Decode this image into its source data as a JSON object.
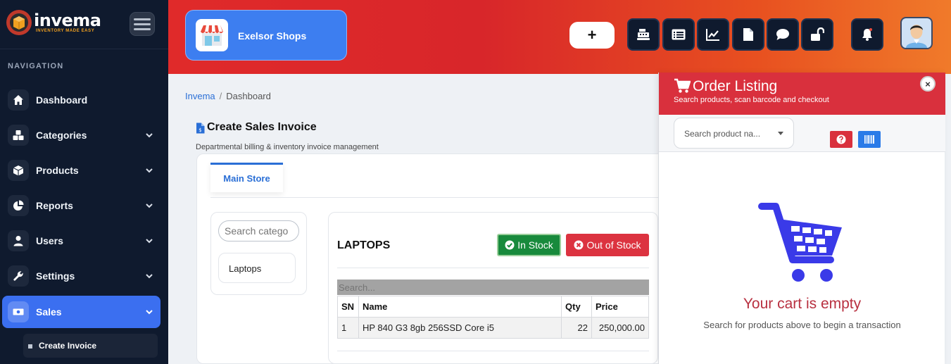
{
  "app": {
    "logo_text": "invema",
    "logo_tagline": "INVENTORY MADE EASY"
  },
  "sidebar": {
    "heading": "NAVIGATION",
    "items": [
      {
        "label": "Dashboard",
        "icon": "home-icon"
      },
      {
        "label": "Categories",
        "icon": "cubes-icon"
      },
      {
        "label": "Products",
        "icon": "box-icon"
      },
      {
        "label": "Reports",
        "icon": "pie-chart-icon"
      },
      {
        "label": "Users",
        "icon": "user-icon"
      },
      {
        "label": "Settings",
        "icon": "wrench-icon"
      },
      {
        "label": "Sales",
        "icon": "money-icon"
      }
    ],
    "active_item": "Sales",
    "subitems": [
      {
        "label": "Create Invoice"
      }
    ]
  },
  "header": {
    "shop_name": "Exelsor Shops",
    "add_label": "+",
    "tools": [
      "cash-register-icon",
      "list-icon",
      "line-chart-icon",
      "file-icon",
      "comment-icon",
      "unlock-icon"
    ],
    "notification_icon": "bell-icon"
  },
  "breadcrumb": {
    "root": "Invema",
    "separator": "/",
    "current": "Dashboard"
  },
  "page": {
    "title": "Create Sales Invoice",
    "subtitle": "Departmental billing & inventory invoice management"
  },
  "tabs": [
    {
      "label": "Main Store",
      "active": true
    }
  ],
  "categories": {
    "search_placeholder": "Search catego",
    "items": [
      "Laptops"
    ]
  },
  "products": {
    "title": "LAPTOPS",
    "in_stock_label": "In Stock",
    "out_stock_label": "Out of Stock",
    "search_placeholder": "Search...",
    "columns": [
      "SN",
      "Name",
      "Qty",
      "Price"
    ],
    "rows": [
      {
        "sn": "1",
        "name": "HP 840 G3 8gb 256SSD Core i5",
        "qty": "22",
        "price": "250,000.00"
      }
    ]
  },
  "order": {
    "title": "Order Listing",
    "subtitle": "Search products, scan barcode and checkout",
    "close_label": "×",
    "product_select_placeholder": "Search product na...",
    "empty_title": "Your cart is empty",
    "empty_subtitle": "Search for products above to begin a transaction"
  },
  "colors": {
    "sidebar_bg": "#0f1a2e",
    "accent_blue": "#3b6ff0",
    "header_red": "#d9303d",
    "in_stock_green": "#188a3c",
    "out_stock_red": "#dc3340",
    "cart_blue": "#3a3ae8"
  }
}
